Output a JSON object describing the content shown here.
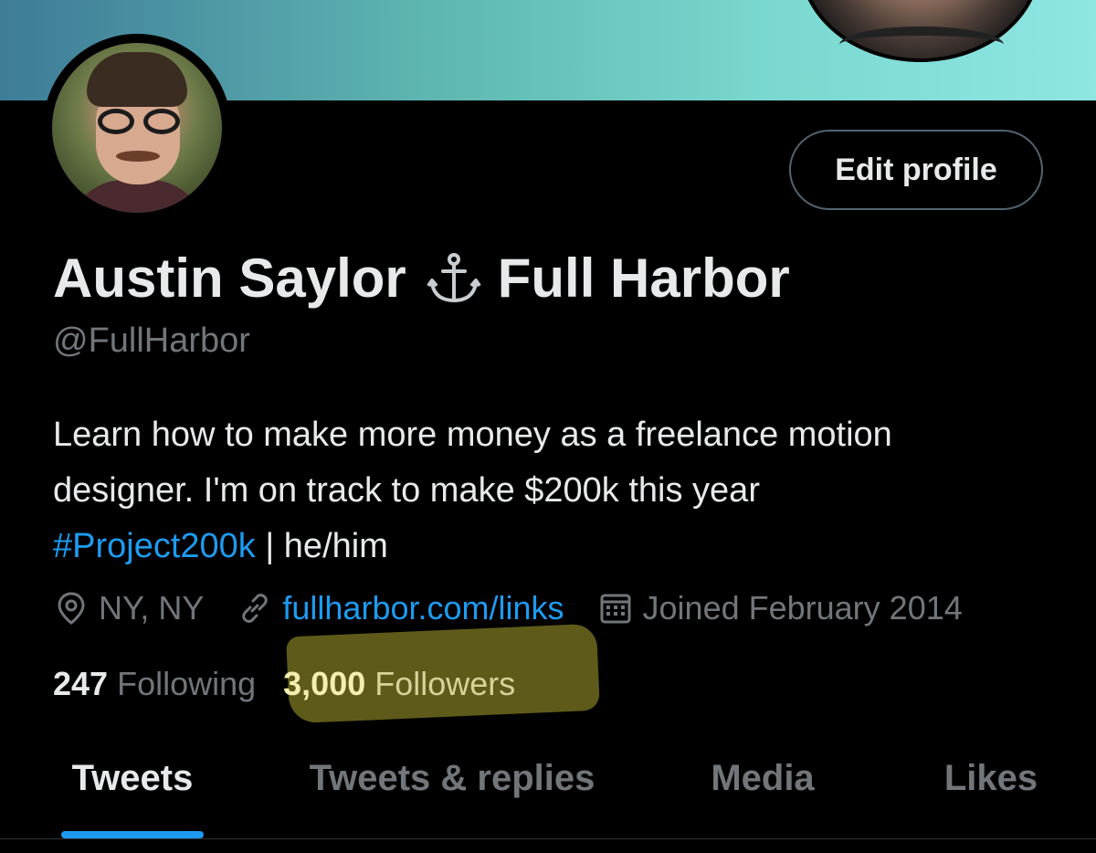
{
  "profile": {
    "name_part1": "Austin Saylor",
    "name_part2": "Full Harbor",
    "handle": "@FullHarbor",
    "bio_line1": "Learn how to make more money as a freelance motion",
    "bio_line2": "designer. I'm on track to make $200k this year",
    "bio_hashtag": "#Project200k",
    "bio_suffix": " | he/him",
    "location": "NY, NY",
    "website": "fullharbor.com/links",
    "joined": "Joined February 2014"
  },
  "stats": {
    "following_count": "247",
    "following_label": "Following",
    "followers_count": "3,000",
    "followers_label": "Followers"
  },
  "actions": {
    "edit_profile_label": "Edit profile"
  },
  "tabs": [
    {
      "label": "Tweets",
      "active": true
    },
    {
      "label": "Tweets & replies",
      "active": false
    },
    {
      "label": "Media",
      "active": false
    },
    {
      "label": "Likes",
      "active": false
    }
  ],
  "colors": {
    "background": "#000000",
    "text_primary": "#e7e9ea",
    "text_secondary": "#71767b",
    "accent": "#1d9bf0",
    "highlight": "#6e6a1e"
  },
  "icons": {
    "name_emoji": "anchor-icon",
    "location": "location-pin-icon",
    "website": "link-icon",
    "joined": "calendar-icon"
  }
}
